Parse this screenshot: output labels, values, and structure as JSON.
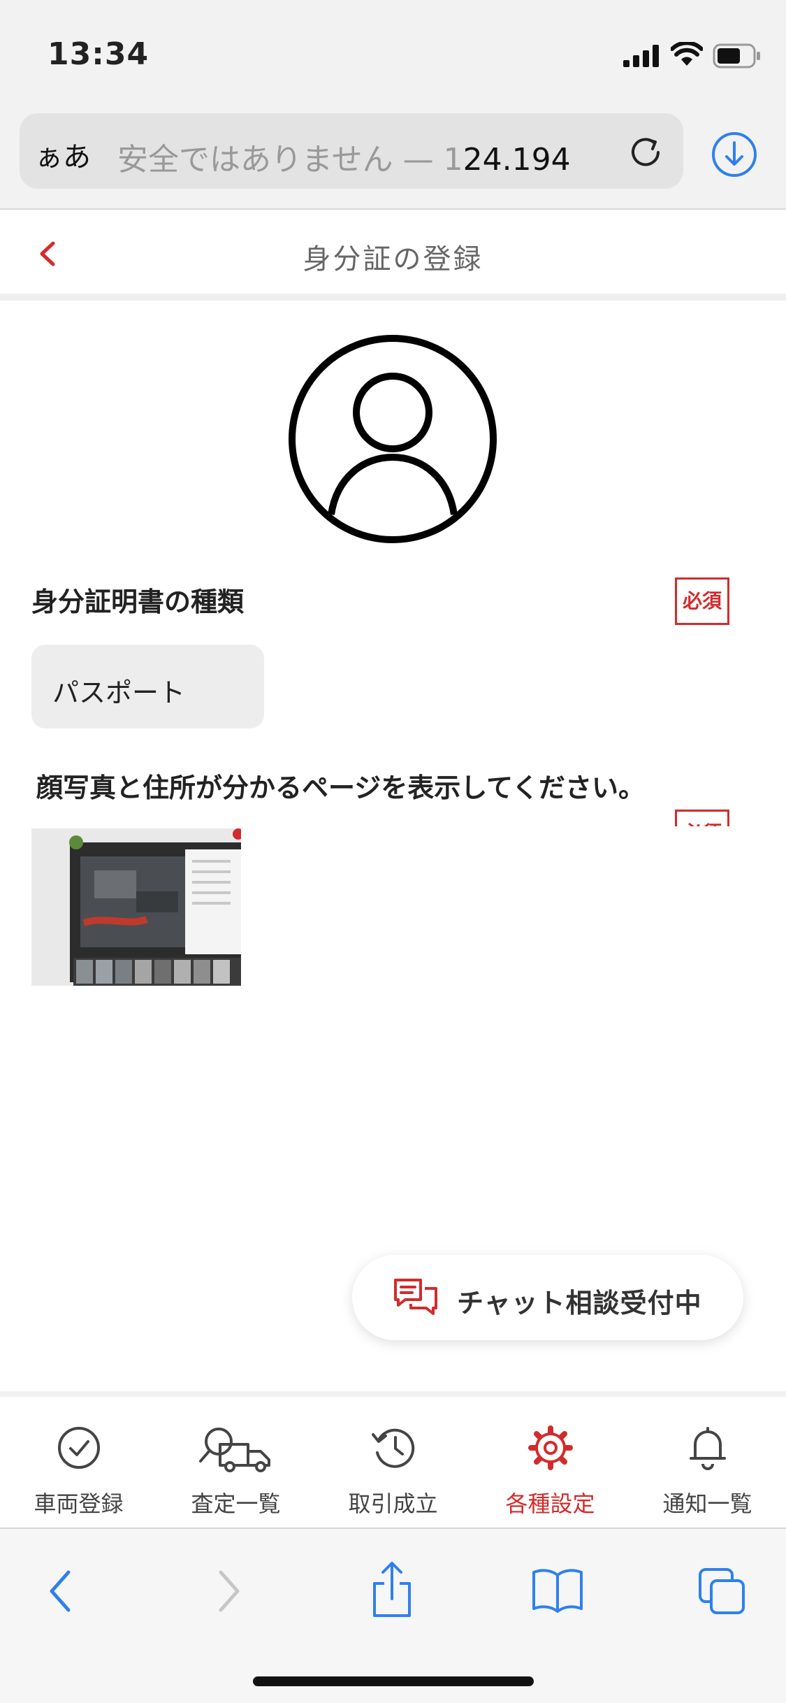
{
  "status": {
    "time": "13:34"
  },
  "browser": {
    "text_size_label": "ぁあ",
    "url_prefix": "安全ではありません — 1",
    "url_host": "24.194"
  },
  "header": {
    "title": "身分証の登録"
  },
  "form": {
    "id_type_label": "身分証明書の種類",
    "required_badge": "必須",
    "id_type_value": "パスポート",
    "photo_instruction": "顔写真と住所が分かるページを表示してください。",
    "photo_required_badge": "必須"
  },
  "chat": {
    "label": "チャット相談受付中"
  },
  "tabs": [
    {
      "label": "車両登録",
      "icon": "check-circle-icon"
    },
    {
      "label": "査定一覧",
      "icon": "truck-search-icon"
    },
    {
      "label": "取引成立",
      "icon": "history-icon"
    },
    {
      "label": "各種設定",
      "icon": "gear-icon",
      "active": true
    },
    {
      "label": "通知一覧",
      "icon": "bell-icon"
    }
  ],
  "colors": {
    "accent": "#d32b2b",
    "ios_blue": "#2f80ed"
  }
}
